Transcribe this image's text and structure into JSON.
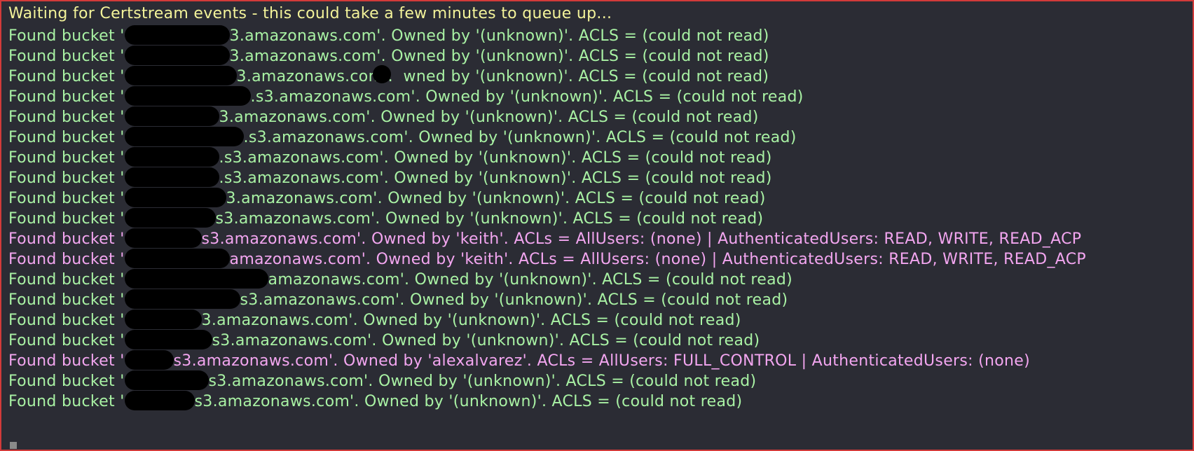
{
  "header_line": "Waiting for Certstream events - this could take a few minutes to queue up...",
  "lines": [
    {
      "prefix": "Found bucket '",
      "suffix": "3.amazonaws.com'. Owned by '(unknown)'. ACLS = (could not read)",
      "color": "green"
    },
    {
      "prefix": "Found bucket '",
      "suffix": "3.amazonaws.com'. Owned by '(unknown)'. ACLS = (could not read)",
      "color": "green"
    },
    {
      "prefix": "Found bucket '",
      "suffix": "3.amazonaws.com'.  wned by '(unknown)'. ACLS = (could not read)",
      "color": "green"
    },
    {
      "prefix": "Found bucket '",
      "suffix": ".s3.amazonaws.com'. Owned by '(unknown)'. ACLS = (could not read)",
      "color": "green"
    },
    {
      "prefix": "Found bucket '",
      "suffix": "3.amazonaws.com'. Owned by '(unknown)'. ACLS = (could not read)",
      "color": "green"
    },
    {
      "prefix": "Found bucket '",
      "suffix": ".s3.amazonaws.com'. Owned by '(unknown)'. ACLS = (could not read)",
      "color": "green"
    },
    {
      "prefix": "Found bucket '",
      "suffix": ".s3.amazonaws.com'. Owned by '(unknown)'. ACLS = (could not read)",
      "color": "green"
    },
    {
      "prefix": "Found bucket '",
      "suffix": ".s3.amazonaws.com'. Owned by '(unknown)'. ACLS = (could not read)",
      "color": "green"
    },
    {
      "prefix": "Found bucket '",
      "suffix": "3.amazonaws.com'. Owned by '(unknown)'. ACLS = (could not read)",
      "color": "green"
    },
    {
      "prefix": "Found bucket '",
      "suffix": "s3.amazonaws.com'. Owned by '(unknown)'. ACLS = (could not read)",
      "color": "green"
    },
    {
      "prefix": "Found bucket '",
      "suffix": "s3.amazonaws.com'. Owned by 'keith'. ACLs = AllUsers: (none) | AuthenticatedUsers: READ, WRITE, READ_ACP",
      "color": "pink"
    },
    {
      "prefix": "Found bucket '",
      "suffix": "amazonaws.com'. Owned by 'keith'. ACLs = AllUsers: (none) | AuthenticatedUsers: READ, WRITE, READ_ACP",
      "color": "pink"
    },
    {
      "prefix": "Found bucket '",
      "suffix": "amazonaws.com'. Owned by '(unknown)'. ACLS = (could not read)",
      "color": "green"
    },
    {
      "prefix": "Found bucket '",
      "suffix": "s3.amazonaws.com'. Owned by '(unknown)'. ACLS = (could not read)",
      "color": "green"
    },
    {
      "prefix": "Found bucket '",
      "suffix": "3.amazonaws.com'. Owned by '(unknown)'. ACLS = (could not read)",
      "color": "green"
    },
    {
      "prefix": "Found bucket '",
      "suffix": "s3.amazonaws.com'. Owned by '(unknown)'. ACLS = (could not read)",
      "color": "green"
    },
    {
      "prefix": "Found bucket '",
      "suffix": "s3.amazonaws.com'. Owned by 'alexalvarez'. ACLs = AllUsers: FULL_CONTROL | AuthenticatedUsers: (none)",
      "color": "pink"
    },
    {
      "prefix": "Found bucket '",
      "suffix": "s3.amazonaws.com'. Owned by '(unknown)'. ACLS = (could not read)",
      "color": "green"
    },
    {
      "prefix": "Found bucket '",
      "suffix": "s3.amazonaws.com'. Owned by '(unknown)'. ACLS = (could not read)",
      "color": "green"
    }
  ]
}
